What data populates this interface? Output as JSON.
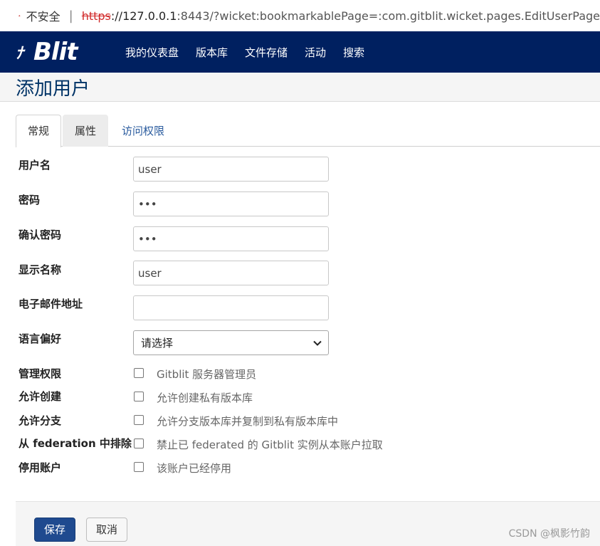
{
  "browser": {
    "insecure_label": "不安全",
    "separator": "|",
    "url_scheme": "https",
    "url_host": "://127.0.0.1",
    "url_rest": ":8443/?wicket:bookmarkablePage=:com.gitblit.wicket.pages.EditUserPage"
  },
  "navbar": {
    "logo_text": "Blit",
    "items": [
      "我的仪表盘",
      "版本库",
      "文件存储",
      "活动",
      "搜索"
    ]
  },
  "page": {
    "title": "添加用户"
  },
  "tabs": [
    {
      "label": "常规",
      "state": "active"
    },
    {
      "label": "属性",
      "state": "hover"
    },
    {
      "label": "访问权限",
      "state": "normal"
    }
  ],
  "form": {
    "username": {
      "label": "用户名",
      "value": "user"
    },
    "password": {
      "label": "密码",
      "value": "•••"
    },
    "confirm_password": {
      "label": "确认密码",
      "value": "•••"
    },
    "display_name": {
      "label": "显示名称",
      "value": "user"
    },
    "email": {
      "label": "电子邮件地址",
      "value": ""
    },
    "language": {
      "label": "语言偏好",
      "selected": "请选择"
    },
    "checkboxes": [
      {
        "label": "管理权限",
        "text": "Gitblit 服务器管理员",
        "checked": false
      },
      {
        "label": "允许创建",
        "text": "允许创建私有版本库",
        "checked": false
      },
      {
        "label": "允许分支",
        "text": "允许分支版本库并复制到私有版本库中",
        "checked": false
      },
      {
        "label": "从 federation 中排除",
        "text": "禁止已 federated 的 Gitblit 实例从本账户拉取",
        "checked": false
      },
      {
        "label": "停用账户",
        "text": "该账户已经停用",
        "checked": false
      }
    ]
  },
  "actions": {
    "save": "保存",
    "cancel": "取消"
  },
  "watermark": "CSDN @枫影竹韵",
  "colors": {
    "navbar": "#002060",
    "primary_button": "#1f4a8f",
    "insecure_icon": "#d12b2b"
  }
}
